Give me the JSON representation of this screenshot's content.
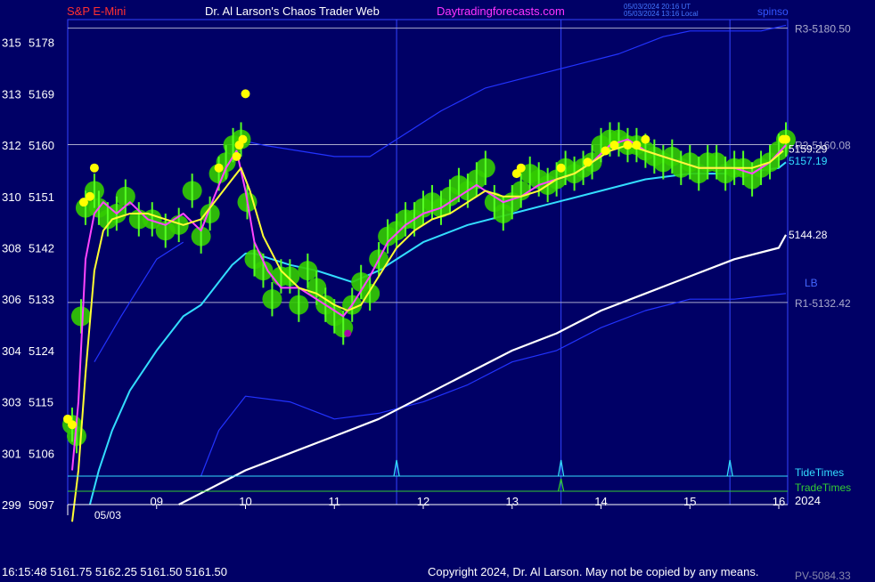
{
  "header": {
    "symbol": "S&P E-Mini",
    "author": "Dr. Al Larson's Chaos Trader Web",
    "site": "Daytradingforecasts.com",
    "time_ut": "05/03/2024 20:16 UT",
    "time_local": "05/03/2024 13:16 Local",
    "corner_label": "spinso"
  },
  "footer": {
    "quote": "16:15:48  5161.75  5162.25  5161.50  5161.50",
    "copyright": "Copyright 2024, Dr. Al Larson. May not be copied by any means.",
    "pv": "PV-5084.33"
  },
  "colors": {
    "background": "#000066",
    "price_bars": "#33cc00",
    "yellow_avg": "#ffff33",
    "magenta_avg": "#ff44ff",
    "cyan_avg": "#33ddff",
    "white_avg": "#ffffff",
    "blue_band": "#2233ff",
    "dots": "#ffff00",
    "low_dot": "#aa00aa",
    "axis": "#ffffff",
    "level_line": "#aaaacc"
  },
  "chart_data": {
    "type": "line",
    "y_axis": {
      "ylim": [
        5097,
        5182
      ],
      "ticks": [
        {
          "degree": "315",
          "price": "5178",
          "value": 5178
        },
        {
          "degree": "313",
          "price": "5169",
          "value": 5169
        },
        {
          "degree": "312",
          "price": "5160",
          "value": 5160
        },
        {
          "degree": "310",
          "price": "5151",
          "value": 5151
        },
        {
          "degree": "308",
          "price": "5142",
          "value": 5142
        },
        {
          "degree": "306",
          "price": "5133",
          "value": 5133
        },
        {
          "degree": "304",
          "price": "5124",
          "value": 5124
        },
        {
          "degree": "303",
          "price": "5115",
          "value": 5115
        },
        {
          "degree": "301",
          "price": "5106",
          "value": 5106
        },
        {
          "degree": "299",
          "price": "5097",
          "value": 5097
        }
      ]
    },
    "x_axis": {
      "xlim": [
        8.0,
        16.1
      ],
      "date_label": "05/03",
      "date_at": 8.45,
      "year_label": "2024",
      "ticks": [
        {
          "label": "09",
          "value": 9
        },
        {
          "label": "10",
          "value": 10
        },
        {
          "label": "11",
          "value": 11
        },
        {
          "label": "12",
          "value": 12
        },
        {
          "label": "13",
          "value": 13
        },
        {
          "label": "14",
          "value": 14
        },
        {
          "label": "15",
          "value": 15
        },
        {
          "label": "16",
          "value": 16
        }
      ]
    },
    "levels": [
      {
        "label": "R3-5180.50",
        "value": 5180.5,
        "color": "#aaaacc"
      },
      {
        "label": "R2-5160.08",
        "value": 5160.08,
        "color": "#aaaacc"
      },
      {
        "label": "R1-5132.42",
        "value": 5132.42,
        "color": "#aaaacc"
      }
    ],
    "value_labels": [
      {
        "label": "5159.29",
        "value": 5159.29,
        "color": "#ffffff"
      },
      {
        "label": "5157.19",
        "value": 5157.19,
        "color": "#33ddff"
      },
      {
        "label": "5144.28",
        "value": 5144.28,
        "color": "#ffffff"
      }
    ],
    "side_label": "LB",
    "tide_label": "TideTimes",
    "trade_label": "TradeTimes",
    "tide_spikes": [
      11.7,
      13.55,
      15.45
    ],
    "trade_spikes": [
      13.55
    ],
    "vertical_markers": [
      11.7,
      13.55,
      15.45
    ],
    "series": {
      "price": {
        "x": [
          8.05,
          8.1,
          8.15,
          8.2,
          8.3,
          8.35,
          8.45,
          8.55,
          8.65,
          8.8,
          8.95,
          9.1,
          9.25,
          9.4,
          9.5,
          9.6,
          9.7,
          9.78,
          9.86,
          9.95,
          10.02,
          10.1,
          10.2,
          10.3,
          10.4,
          10.5,
          10.6,
          10.7,
          10.8,
          10.9,
          11.0,
          11.1,
          11.2,
          11.3,
          11.4,
          11.5,
          11.6,
          11.7,
          11.8,
          11.9,
          12.0,
          12.1,
          12.2,
          12.3,
          12.4,
          12.5,
          12.6,
          12.7,
          12.8,
          12.9,
          13.0,
          13.1,
          13.2,
          13.3,
          13.4,
          13.5,
          13.6,
          13.7,
          13.8,
          13.9,
          14.0,
          14.1,
          14.2,
          14.3,
          14.4,
          14.5,
          14.6,
          14.7,
          14.8,
          14.9,
          15.0,
          15.1,
          15.2,
          15.3,
          15.4,
          15.5,
          15.6,
          15.7,
          15.8,
          15.9,
          16.0,
          16.08
        ],
        "y": [
          5111,
          5109,
          5130,
          5149,
          5152,
          5149,
          5147,
          5148,
          5151,
          5147,
          5147,
          5145,
          5146,
          5152,
          5144,
          5148,
          5155,
          5157,
          5160,
          5161,
          5150,
          5140,
          5138,
          5133,
          5137,
          5137,
          5132,
          5138,
          5135,
          5132,
          5130,
          5128,
          5132,
          5136,
          5134,
          5140,
          5144,
          5145,
          5147,
          5147,
          5149,
          5150,
          5149,
          5151,
          5153,
          5152,
          5154,
          5156,
          5150,
          5148,
          5150,
          5152,
          5155,
          5154,
          5153,
          5154,
          5156,
          5155,
          5156,
          5157,
          5160,
          5161,
          5161,
          5160,
          5160,
          5159,
          5158,
          5157,
          5158,
          5156,
          5157,
          5155,
          5157,
          5157,
          5155,
          5156,
          5156,
          5154,
          5156,
          5157,
          5159,
          5161
        ]
      },
      "yellow": {
        "x": [
          8.05,
          8.12,
          8.2,
          8.3,
          8.4,
          8.5,
          8.7,
          8.9,
          9.1,
          9.3,
          9.5,
          9.7,
          9.85,
          9.95,
          10.05,
          10.2,
          10.4,
          10.6,
          10.8,
          11.0,
          11.15,
          11.3,
          11.5,
          11.7,
          11.9,
          12.1,
          12.3,
          12.5,
          12.7,
          12.9,
          13.1,
          13.3,
          13.5,
          13.7,
          13.9,
          14.1,
          14.3,
          14.5,
          14.7,
          14.9,
          15.1,
          15.3,
          15.5,
          15.7,
          15.9,
          16.05
        ],
        "y": [
          5094,
          5103,
          5120,
          5138,
          5145,
          5147,
          5148,
          5148,
          5147,
          5146,
          5147,
          5151,
          5154,
          5156,
          5152,
          5144,
          5138,
          5135,
          5134,
          5132,
          5131,
          5132,
          5137,
          5142,
          5145,
          5147,
          5148,
          5150,
          5152,
          5151,
          5151,
          5152,
          5154,
          5155,
          5157,
          5159,
          5160,
          5159,
          5158,
          5157,
          5156,
          5156,
          5156,
          5156,
          5157,
          5159
        ]
      },
      "magenta": {
        "x": [
          8.05,
          8.12,
          8.2,
          8.3,
          8.4,
          8.55,
          8.7,
          8.9,
          9.1,
          9.3,
          9.5,
          9.65,
          9.78,
          9.9,
          10.0,
          10.1,
          10.25,
          10.4,
          10.6,
          10.8,
          11.0,
          11.1,
          11.2,
          11.4,
          11.6,
          11.8,
          12.0,
          12.2,
          12.4,
          12.6,
          12.7,
          12.9,
          13.1,
          13.3,
          13.5,
          13.7,
          13.9,
          14.1,
          14.3,
          14.5,
          14.7,
          14.9,
          15.1,
          15.3,
          15.5,
          15.7,
          15.9,
          16.08
        ],
        "y": [
          5103,
          5115,
          5140,
          5148,
          5150,
          5148,
          5150,
          5147,
          5146,
          5148,
          5145,
          5151,
          5156,
          5159,
          5152,
          5143,
          5138,
          5135,
          5135,
          5133,
          5131,
          5130,
          5132,
          5137,
          5143,
          5146,
          5148,
          5149,
          5151,
          5153,
          5152,
          5150,
          5151,
          5153,
          5154,
          5155,
          5157,
          5160,
          5161,
          5159,
          5158,
          5157,
          5156,
          5156,
          5156,
          5155,
          5157,
          5160
        ]
      },
      "cyan": {
        "x": [
          8.25,
          8.35,
          8.5,
          8.7,
          9.0,
          9.3,
          9.5,
          9.7,
          9.85,
          10.0,
          10.1,
          10.3,
          10.5,
          10.8,
          11.0,
          11.2,
          11.5,
          11.8,
          12.0,
          12.5,
          13.0,
          13.5,
          14.0,
          14.5,
          15.0,
          15.5,
          16.0,
          16.08
        ],
        "y": [
          5097,
          5103,
          5110,
          5117,
          5124,
          5130,
          5132,
          5136,
          5139,
          5141,
          5141,
          5140,
          5139,
          5138,
          5137,
          5136,
          5138,
          5141,
          5143,
          5146,
          5148,
          5150,
          5152,
          5154,
          5155,
          5155,
          5156,
          5157
        ]
      },
      "white": {
        "x": [
          9.25,
          9.5,
          9.75,
          10.0,
          10.5,
          11.0,
          11.5,
          12.0,
          12.5,
          13.0,
          13.5,
          14.0,
          14.5,
          15.0,
          15.5,
          16.0,
          16.08
        ],
        "y": [
          5097,
          5099,
          5101,
          5103,
          5106,
          5109,
          5112,
          5116,
          5120,
          5124,
          5127,
          5131,
          5134,
          5137,
          5140,
          5142,
          5144.28
        ]
      },
      "band_upper": {
        "x": [
          9.9,
          10.2,
          10.6,
          11.0,
          11.4,
          11.7,
          12.2,
          12.7,
          13.2,
          13.7,
          14.2,
          14.7,
          15.0,
          15.4,
          15.8,
          16.08
        ],
        "y": [
          5161,
          5160,
          5159,
          5158,
          5158,
          5161,
          5166,
          5170,
          5172,
          5174,
          5176,
          5179,
          5180,
          5180,
          5180,
          5181
        ]
      },
      "band_lower": {
        "x": [
          9.5,
          9.7,
          10.0,
          10.5,
          11.0,
          11.5,
          12.0,
          12.5,
          13.0,
          13.5,
          14.0,
          14.5,
          15.0,
          15.5,
          16.08
        ],
        "y": [
          5102,
          5110,
          5116,
          5115,
          5112,
          5113,
          5115,
          5118,
          5122,
          5124,
          5128,
          5131,
          5133,
          5133,
          5134
        ]
      },
      "blue_early": {
        "x": [
          8.3,
          8.6,
          9.0,
          9.3
        ],
        "y": [
          5122,
          5130,
          5140,
          5143
        ]
      },
      "dots": {
        "x": [
          8.0,
          8.05,
          8.18,
          8.25,
          8.3,
          9.7,
          9.9,
          9.93,
          9.97,
          10.0,
          13.05,
          13.1,
          13.55,
          13.85,
          14.05,
          14.15,
          14.3,
          14.4,
          14.5,
          16.05,
          16.08
        ],
        "y": [
          5112,
          5111,
          5150,
          5151,
          5156,
          5156,
          5158,
          5160,
          5161,
          5169,
          5155,
          5156,
          5156,
          5157,
          5159,
          5160,
          5160,
          5160,
          5161,
          5161,
          5161
        ]
      },
      "low_dot": {
        "x": 11.15,
        "y": 5127
      }
    }
  }
}
